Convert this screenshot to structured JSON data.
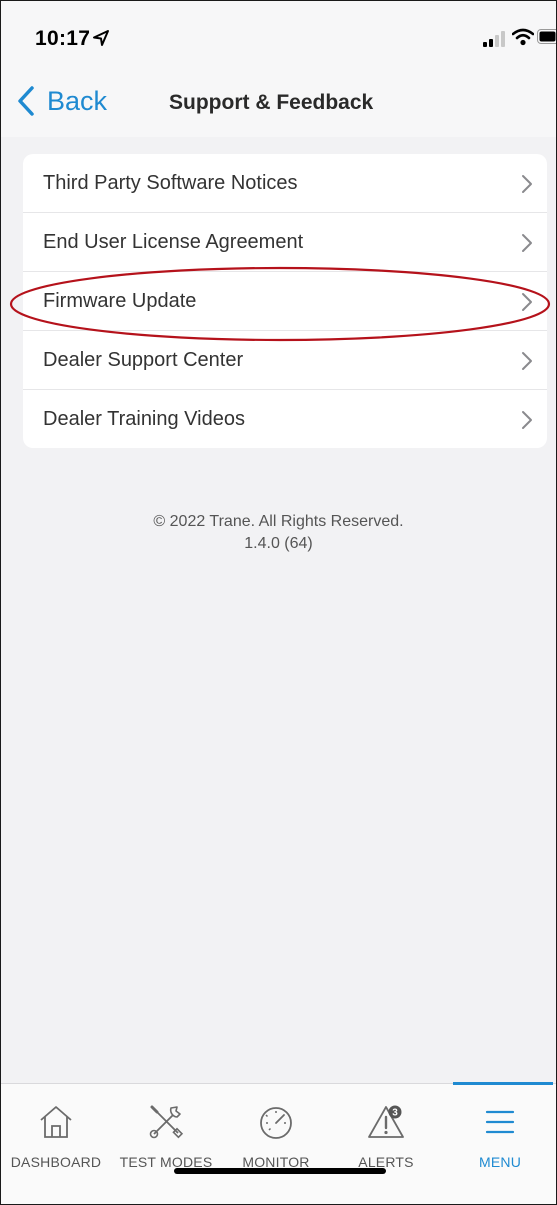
{
  "status_bar": {
    "time": "10:17",
    "icons": [
      "location-arrow-icon",
      "signal-icon",
      "wifi-icon",
      "battery-icon"
    ]
  },
  "nav": {
    "back_label": "Back",
    "title": "Support & Feedback"
  },
  "menu_items": [
    {
      "label": "Third Party Software Notices",
      "icon": "chevron-right-icon"
    },
    {
      "label": "End User License Agreement",
      "icon": "chevron-right-icon"
    },
    {
      "label": "Firmware Update",
      "icon": "chevron-right-icon",
      "highlighted": true
    },
    {
      "label": "Dealer Support Center",
      "icon": "chevron-right-icon"
    },
    {
      "label": "Dealer Training Videos",
      "icon": "chevron-right-icon"
    }
  ],
  "footer": {
    "copyright": "© 2022 Trane. All Rights Reserved.",
    "version": "1.4.0 (64)"
  },
  "tabs": [
    {
      "label": "DASHBOARD",
      "icon": "house-icon",
      "active": false
    },
    {
      "label": "TEST MODES",
      "icon": "tools-icon",
      "active": false
    },
    {
      "label": "MONITOR",
      "icon": "gauge-icon",
      "active": false
    },
    {
      "label": "ALERTS",
      "icon": "alert-triangle-icon",
      "active": false,
      "badge": "3"
    },
    {
      "label": "MENU",
      "icon": "hamburger-menu-icon",
      "active": true
    }
  ],
  "colors": {
    "accent": "#1f8ad1",
    "highlight_ring": "#b5121b",
    "background": "#f2f2f4"
  }
}
